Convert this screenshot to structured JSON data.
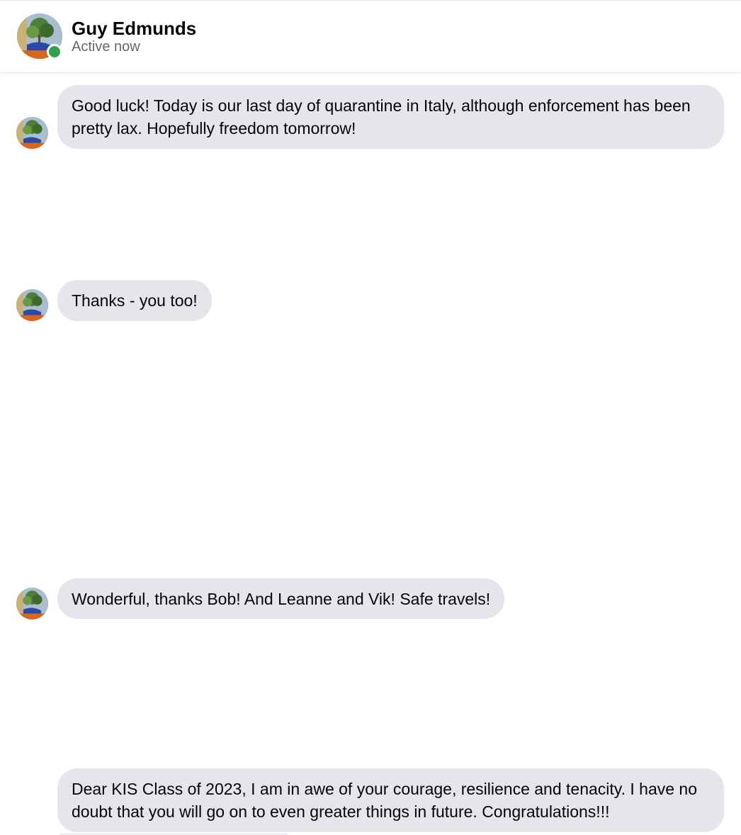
{
  "header": {
    "contact_name": "Guy Edmunds",
    "status": "Active now",
    "avatar_icon": "profile-photo-avatar",
    "online_color": "#31a24c"
  },
  "messages": [
    {
      "sender": "Guy Edmunds",
      "text": "Good luck! Today is our last day of quarantine in Italy, although enforcement has been pretty lax. Hopefully freedom tomorrow!"
    },
    {
      "sender": "Guy Edmunds",
      "text": "Thanks - you too!"
    },
    {
      "sender": "Guy Edmunds",
      "text": "Wonderful, thanks Bob! And Leanne and Vik! Safe travels!"
    },
    {
      "sender": "Guy Edmunds",
      "text": "Dear KIS Class of 2023, I am in awe of your courage, resilience and tenacity. I have no doubt that you will go on to even greater things in future. Congratulations!!!"
    }
  ],
  "colors": {
    "bubble_bg": "#e4e6eb",
    "text": "#050505",
    "status_text": "#65676b"
  }
}
